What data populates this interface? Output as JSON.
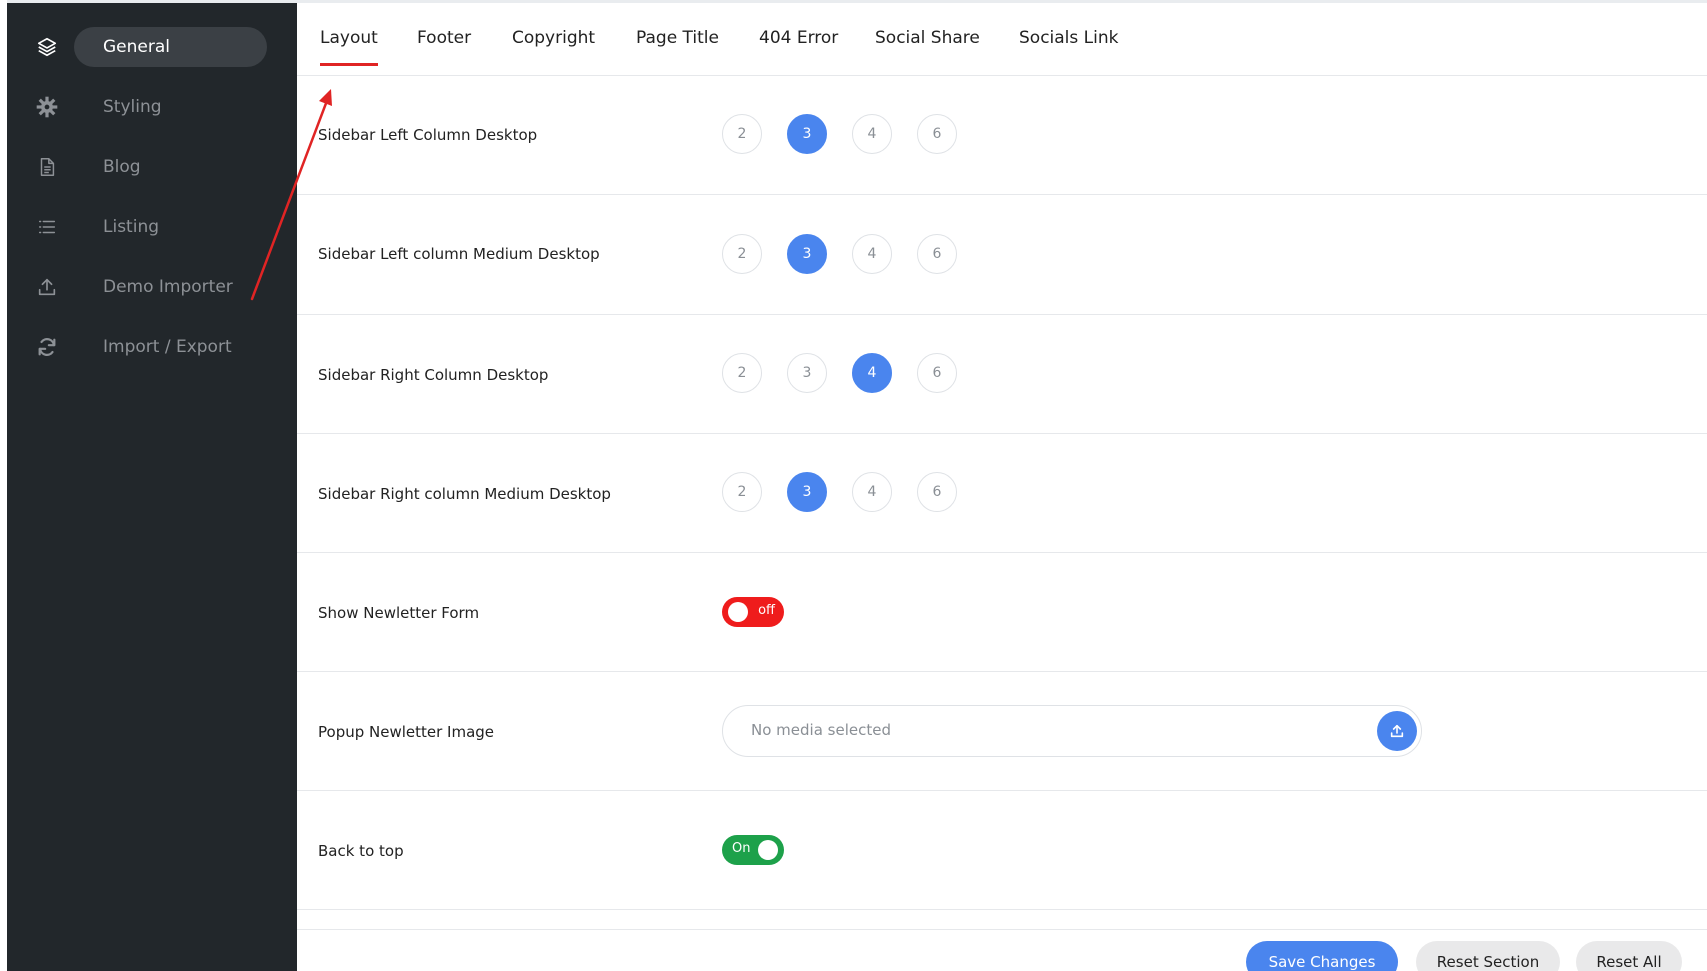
{
  "sidebar": {
    "items": [
      {
        "label": "General",
        "icon": "layers-icon",
        "active": true
      },
      {
        "label": "Styling",
        "icon": "gear-icon",
        "active": false
      },
      {
        "label": "Blog",
        "icon": "document-icon",
        "active": false
      },
      {
        "label": "Listing",
        "icon": "list-icon",
        "active": false
      },
      {
        "label": "Demo Importer",
        "icon": "upload-icon",
        "active": false
      },
      {
        "label": "Import / Export",
        "icon": "refresh-icon",
        "active": false
      }
    ]
  },
  "tabs": [
    {
      "label": "Layout",
      "active": true
    },
    {
      "label": "Footer"
    },
    {
      "label": "Copyright"
    },
    {
      "label": "Page Title"
    },
    {
      "label": "404 Error"
    },
    {
      "label": "Social Share"
    },
    {
      "label": "Socials Link"
    }
  ],
  "settings": {
    "sidebar_left_desktop": {
      "label": "Sidebar Left Column Desktop",
      "options": [
        "2",
        "3",
        "4",
        "6"
      ],
      "selected": "3"
    },
    "sidebar_left_medium": {
      "label": "Sidebar Left column Medium Desktop",
      "options": [
        "2",
        "3",
        "4",
        "6"
      ],
      "selected": "3"
    },
    "sidebar_right_desktop": {
      "label": "Sidebar Right Column Desktop",
      "options": [
        "2",
        "3",
        "4",
        "6"
      ],
      "selected": "4"
    },
    "sidebar_right_medium": {
      "label": "Sidebar Right column Medium Desktop",
      "options": [
        "2",
        "3",
        "4",
        "6"
      ],
      "selected": "3"
    },
    "newsletter_form": {
      "label": "Show Newletter Form",
      "state_text": "off"
    },
    "newsletter_image": {
      "label": "Popup Newletter Image",
      "placeholder": "No media selected",
      "button_icon": "upload-icon"
    },
    "back_to_top": {
      "label": "Back to top",
      "state_text": "On"
    }
  },
  "actions": {
    "save": "Save Changes",
    "reset_section": "Reset Section",
    "reset_all": "Reset All"
  },
  "colors": {
    "sidebar_bg": "#22272b",
    "accent": "#4a85ee",
    "tab_underline": "#e02424",
    "toggle_off": "#ef1c1c",
    "toggle_on": "#1da14a",
    "annotation_arrow": "#e02424"
  }
}
